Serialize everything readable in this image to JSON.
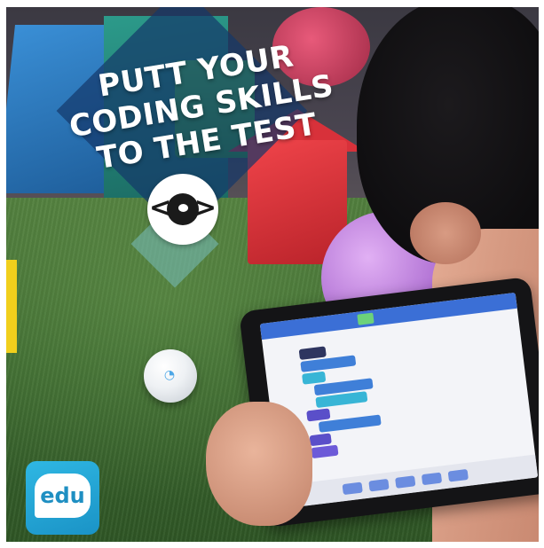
{
  "headline": {
    "line1": "PUTT YOUR",
    "line2": "CODING SKILLS",
    "line3": "TO THE TEST"
  },
  "badge": {
    "left_bracket": "<",
    "right_bracket": ">"
  },
  "logo": {
    "text": "edu"
  },
  "colors": {
    "overlay_blue": "#143769",
    "overlay_teal": "#78bebe",
    "logo_blue": "#1a93c6",
    "tablet_bar": "#3b6fd6"
  }
}
